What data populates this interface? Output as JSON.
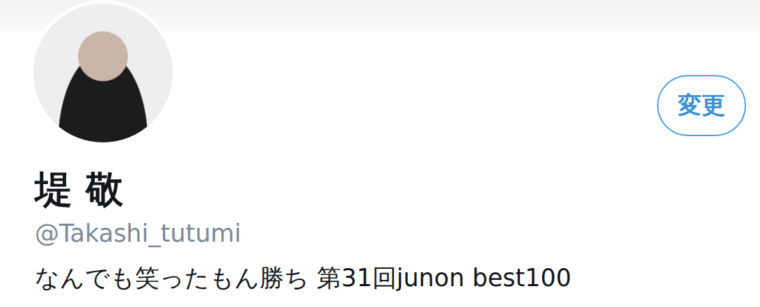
{
  "profile": {
    "name": "堤 敬",
    "handle": "@Takashi_tutumi",
    "bio": "なんでも笑ったもん勝ち 第31回junon best100"
  },
  "buttons": [
    {
      "label": "変更"
    }
  ]
}
